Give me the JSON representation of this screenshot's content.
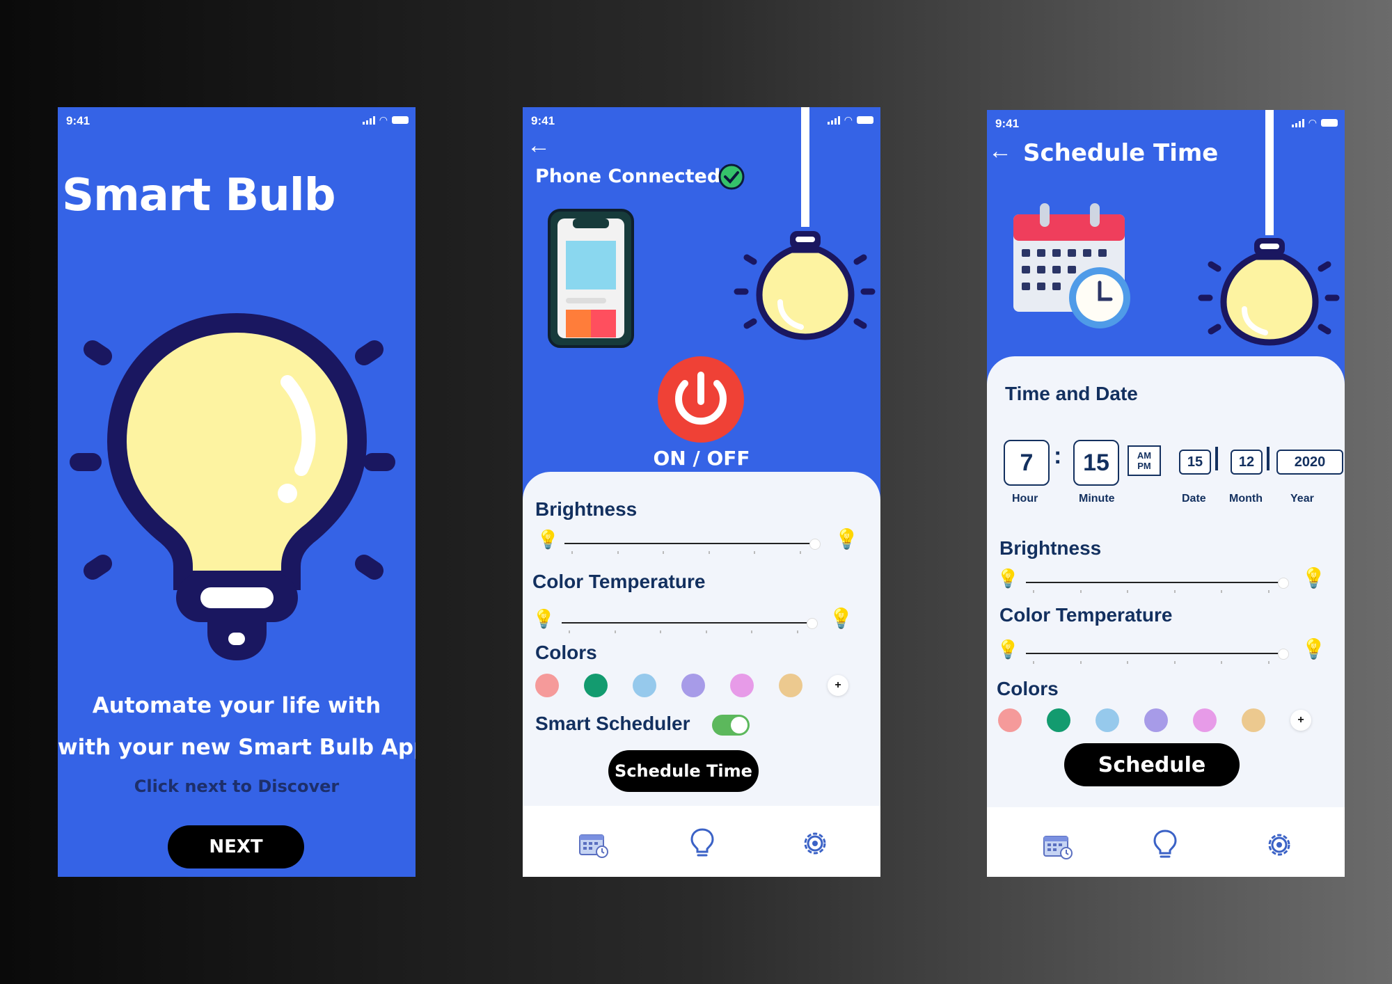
{
  "status_time": "9:41",
  "screen1": {
    "title": "Smart Bulb",
    "tagline_line1": "Automate your life with",
    "tagline_line2": "with your new  Smart Bulb App",
    "hint": "Click next to Discover",
    "next_label": "NEXT"
  },
  "screen2": {
    "connection_label": "Phone Connected",
    "power_label": "ON / OFF",
    "brightness_label": "Brightness",
    "color_temp_label": "Color Temperature",
    "colors_label": "Colors",
    "scheduler_label": "Smart Scheduler",
    "scheduler_on": true,
    "schedule_button": "Schedule Time",
    "brightness_level": 0.95,
    "color_temp_level": 0.95
  },
  "screen3": {
    "header_title": "Schedule Time",
    "section_title": "Time and Date",
    "hour": "7",
    "minute": "15",
    "am_label": "AM",
    "pm_label": "PM",
    "date": "15",
    "month": "12",
    "year": "2020",
    "hour_label": "Hour",
    "minute_label": "Minute",
    "date_label": "Date",
    "month_label": "Month",
    "year_label": "Year",
    "brightness_label": "Brightness",
    "color_temp_label": "Color Temperature",
    "colors_label": "Colors",
    "schedule_button": "Schedule"
  },
  "swatches": [
    "#f59a9a",
    "#139b6f",
    "#96c9ec",
    "#a79be8",
    "#e79be8",
    "#ecc98f"
  ],
  "colors": {
    "bg_blue": "#3563e6",
    "bulb_yellow": "#fdf3a1",
    "bulb_outline": "#1a1760",
    "power_red": "#ef4136",
    "toggle_green": "#5cb85c"
  },
  "tab_icons": [
    "calendar-icon",
    "bulb-icon",
    "gear-icon"
  ]
}
